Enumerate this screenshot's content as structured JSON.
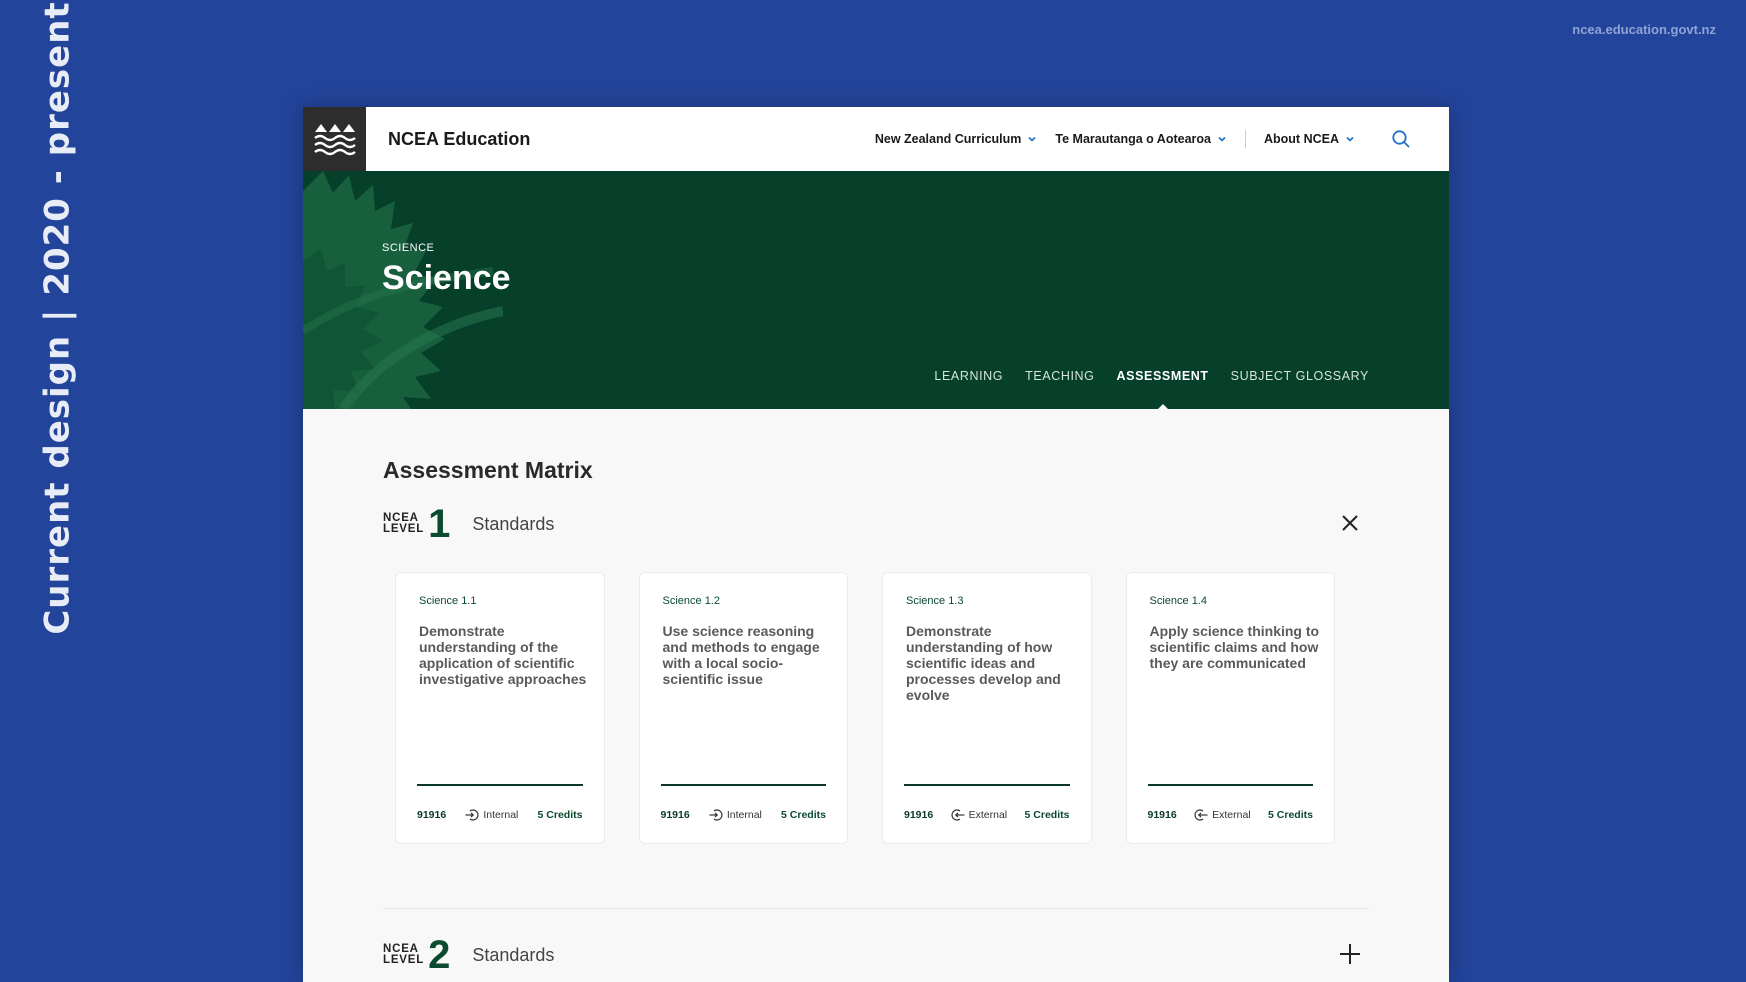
{
  "side_caption": "Current design  |  2020  -  present",
  "site_url": "ncea.education.govt.nz",
  "nav": {
    "brand": "NCEA Education",
    "links": [
      {
        "label": "New Zealand Curriculum"
      },
      {
        "label": "Te Marautanga o Aotearoa"
      },
      {
        "label": "About NCEA"
      }
    ]
  },
  "hero": {
    "eyebrow": "SCIENCE",
    "title": "Science",
    "tabs": [
      "LEARNING",
      "TEACHING",
      "ASSESSMENT",
      "SUBJECT GLOSSARY"
    ],
    "active_tab": "ASSESSMENT"
  },
  "matrix": {
    "title": "Assessment Matrix",
    "levels": [
      {
        "words": [
          "NCEA",
          "LEVEL"
        ],
        "number": "1",
        "label": "Standards",
        "expanded": true,
        "cards": [
          {
            "code": "Science 1.1",
            "title": "Demonstrate understanding of the application of scientific investigative approaches",
            "number": "91916",
            "type": "Internal",
            "credits": "5 Credits"
          },
          {
            "code": "Science 1.2",
            "title": "Use science reasoning and methods to engage with a local socio-scientific issue",
            "number": "91916",
            "type": "Internal",
            "credits": "5 Credits"
          },
          {
            "code": "Science 1.3",
            "title": "Demonstrate understanding of how scientific ideas and processes develop and evolve",
            "number": "91916",
            "type": "External",
            "credits": "5 Credits"
          },
          {
            "code": "Science 1.4",
            "title": "Apply science thinking to scientific claims and how they are communicated",
            "number": "91916",
            "type": "External",
            "credits": "5 Credits"
          }
        ]
      },
      {
        "words": [
          "NCEA",
          "LEVEL"
        ],
        "number": "2",
        "label": "Standards",
        "expanded": false
      }
    ]
  },
  "colors": {
    "page_bg": "#22449a",
    "hero_bg": "#06402a",
    "accent_green": "#0a4a2e",
    "link_blue": "#1f6fc4"
  }
}
